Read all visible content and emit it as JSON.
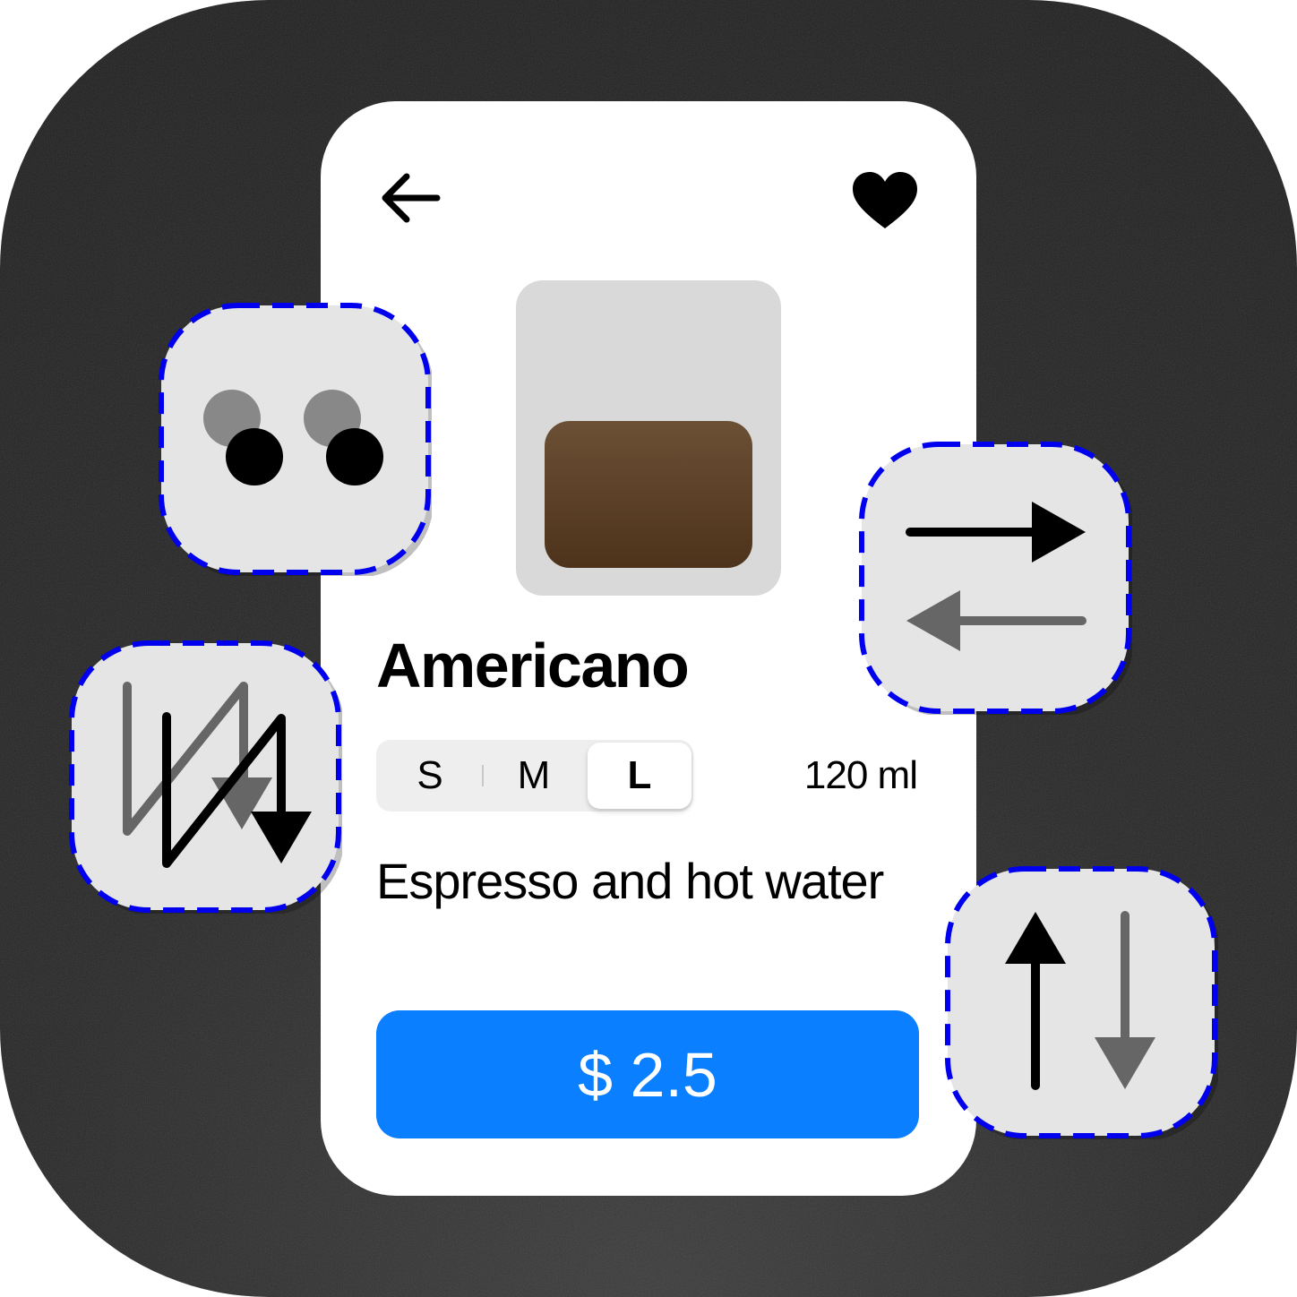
{
  "product": {
    "name": "Americano",
    "volume": "120 ml",
    "description": "Espresso and hot water",
    "price_label": "$ 2.5"
  },
  "sizes": {
    "options": [
      "S",
      "M",
      "L"
    ],
    "selected": "L"
  },
  "header": {
    "back_icon": "arrow-left-icon",
    "favorite_icon": "heart-icon"
  },
  "gesture_cards": [
    {
      "icon": "two-finger-tap-icon"
    },
    {
      "icon": "swipe-horizontal-icon"
    },
    {
      "icon": "zigzag-scribble-icon"
    },
    {
      "icon": "swipe-vertical-icon"
    }
  ],
  "colors": {
    "accent": "#0a7fff",
    "background": "#262626",
    "card": "#e5e5e5",
    "card_border": "#0000ee",
    "coffee": "#5a3d24"
  }
}
